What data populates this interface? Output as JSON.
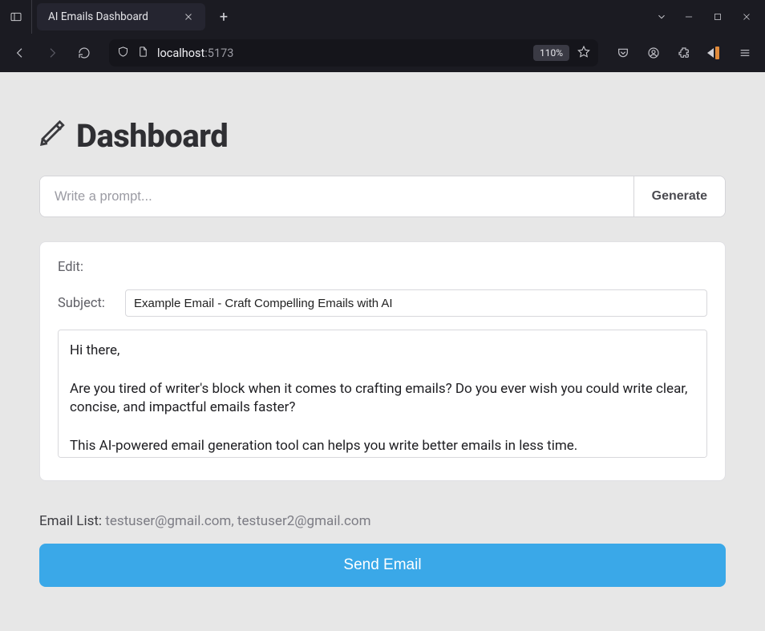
{
  "browser": {
    "tab_title": "AI Emails Dashboard",
    "url_host": "localhost",
    "url_port": ":5173",
    "zoom": "110%"
  },
  "page": {
    "title": "Dashboard",
    "prompt_placeholder": "Write a prompt...",
    "generate_label": "Generate",
    "edit_label": "Edit:",
    "subject_label": "Subject:",
    "subject_value": "Example Email - Craft Compelling Emails with AI",
    "body_value": "Hi there,\n\nAre you tired of writer's block when it comes to crafting emails? Do you ever wish you could write clear, concise, and impactful emails faster?\n\nThis AI-powered email generation tool can helps you write better emails in less time.",
    "email_list_label": "Email List: ",
    "email_list_value": "testuser@gmail.com, testuser2@gmail.com",
    "send_label": "Send Email"
  }
}
